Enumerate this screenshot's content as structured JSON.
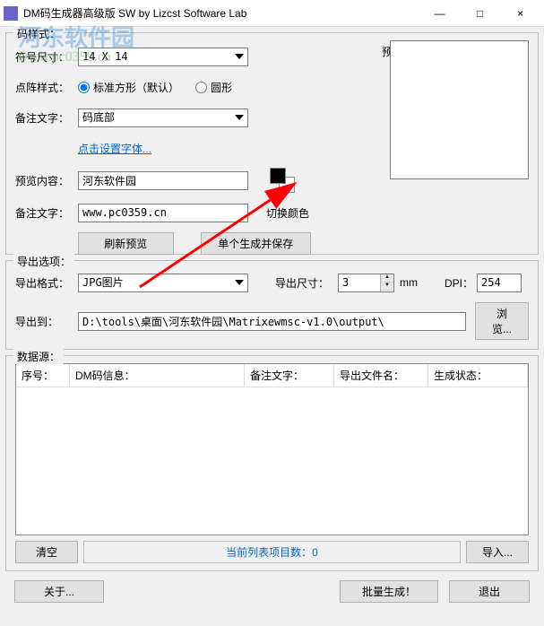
{
  "window": {
    "title": "DM码生成器高级版 SW  by Lizcst Software Lab",
    "minimize": "—",
    "maximize": "□",
    "close": "×"
  },
  "watermark": {
    "main": "河东软件园",
    "sub": "www.pc0359.cn"
  },
  "style_panel": {
    "label": "码样式：",
    "size_label": "符号尺寸：",
    "size_value": "14 X 14",
    "dot_label": "点阵样式：",
    "dot_opt1": "标准方形（默认）",
    "dot_opt2": "圆形",
    "note_label": "备注文字：",
    "note_value": "码底部",
    "font_link": "点击设置字体...",
    "preview_content_label": "预览内容：",
    "preview_content_value": "河东软件园",
    "note_text_label": "备注文字：",
    "note_text_value": "www.pc0359.cn",
    "preview_label": "预览图：",
    "color_label": "切换颜色",
    "refresh_btn": "刷新预览",
    "generate_single_btn": "单个生成并保存"
  },
  "export_panel": {
    "label": "导出选项：",
    "format_label": "导出格式：",
    "format_value": "JPG图片",
    "size_label": "导出尺寸：",
    "size_value": "3",
    "size_unit": "mm",
    "dpi_label": "DPI：",
    "dpi_value": "254",
    "path_label": "导出到：",
    "path_value": "D:\\tools\\桌面\\河东软件园\\Matrixewmsc-v1.0\\output\\",
    "browse_btn": "浏览..."
  },
  "data_panel": {
    "label": "数据源：",
    "columns": {
      "seq": "序号：",
      "info": "DM码信息：",
      "note": "备注文字：",
      "filename": "导出文件名：",
      "status": "生成状态："
    },
    "rows": [],
    "clear_btn": "清空",
    "status_text": "当前列表项目数：0",
    "import_btn": "导入..."
  },
  "footer": {
    "about": "关于...",
    "batch": "批量生成！",
    "exit": "退出"
  }
}
